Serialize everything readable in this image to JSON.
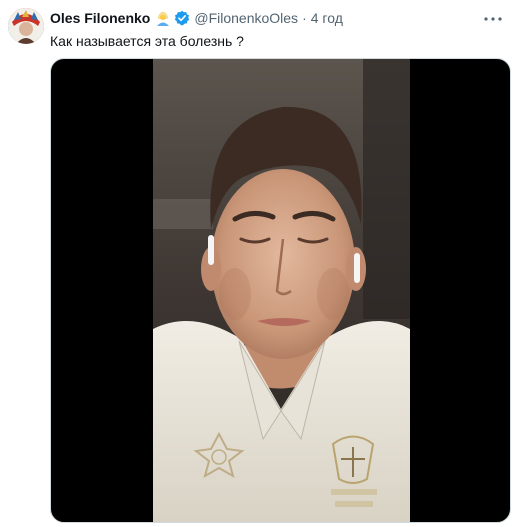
{
  "tweet": {
    "author_name": "Oles Filonenko",
    "emoji_icon": "person-emoji-icon",
    "verified_icon": "verified-badge-icon",
    "handle": "@FilonenkoOles",
    "separator": "·",
    "timestamp": "4 год",
    "more_icon": "more-options-icon",
    "text": "Как называется эта болезнь ?"
  },
  "colors": {
    "text_primary": "#0f1419",
    "text_secondary": "#536471",
    "verified": "#1d9bf0",
    "media_background": "#000000"
  }
}
